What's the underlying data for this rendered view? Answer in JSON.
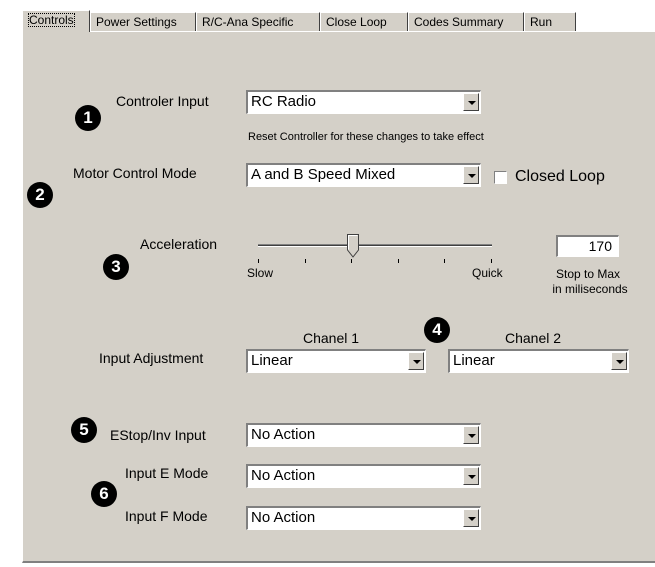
{
  "tabs": [
    "Controls",
    "Power Settings",
    "R/C-Ana Specific",
    "Close Loop",
    "Codes Summary",
    "Run"
  ],
  "active_tab": "Controls",
  "badges": [
    "1",
    "2",
    "3",
    "4",
    "5",
    "6"
  ],
  "controller_input": {
    "label": "Controler Input",
    "value": "RC Radio",
    "note": "Reset Controller for these changes to take effect"
  },
  "motor_control_mode": {
    "label": "Motor Control Mode",
    "value": "A and B Speed Mixed",
    "closed_loop_label": "Closed Loop",
    "closed_loop_checked": false
  },
  "acceleration": {
    "label": "Acceleration",
    "slow_label": "Slow",
    "quick_label": "Quick",
    "value": "170",
    "unit_line1": "Stop to Max",
    "unit_line2": "in miliseconds",
    "slider_fraction": 0.4
  },
  "input_adjustment": {
    "label": "Input Adjustment",
    "channel1_label": "Chanel 1",
    "channel2_label": "Chanel 2",
    "channel1_value": "Linear",
    "channel2_value": "Linear"
  },
  "estop_input": {
    "label": "EStop/Inv Input",
    "value": "No Action"
  },
  "input_e_mode": {
    "label": "Input E Mode",
    "value": "No Action"
  },
  "input_f_mode": {
    "label": "Input F Mode",
    "value": "No Action"
  },
  "colors": {
    "panel": "#d4d0c8",
    "badge": "#000000"
  }
}
